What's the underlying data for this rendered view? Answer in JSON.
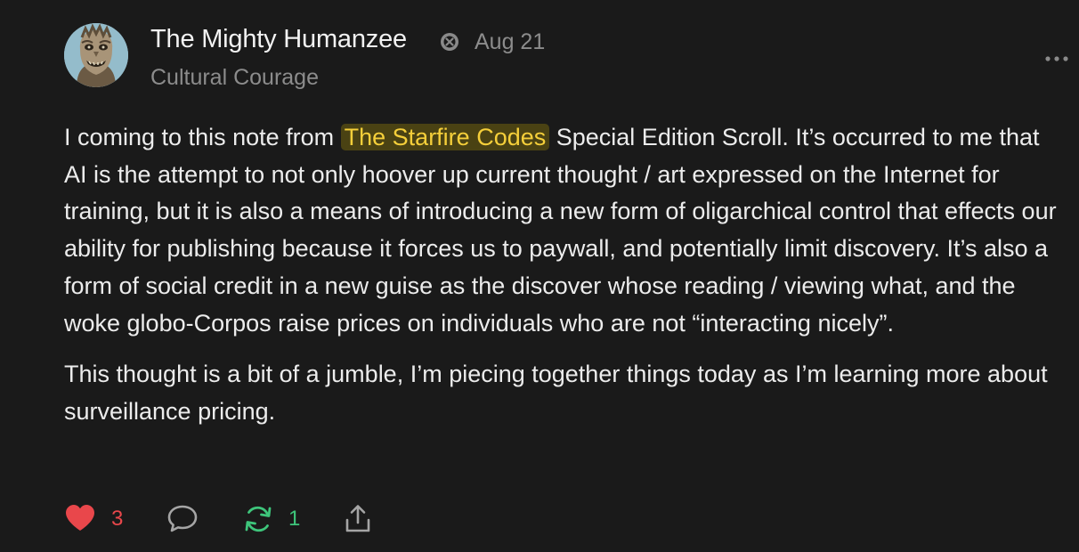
{
  "author": {
    "name": "The Mighty Humanzee",
    "badge_icon": "subscriber-badge-icon",
    "date": "Aug 21",
    "publication": "Cultural Courage"
  },
  "note": {
    "paragraph1": {
      "before_mention": "I coming to this note from ",
      "mention": "The Starfire Codes",
      "after_mention": " Special Edition Scroll. It’s occurred to me that AI is the attempt to not only hoover up current thought / art expressed on the Internet for training, but it is also a means of introducing a new form of oligarchical control that effects our ability for publishing because it forces us to paywall, and potentially limit discovery. It’s also a form of social credit in a new guise as the discover whose reading / viewing what, and the woke globo-Corpos raise prices on individuals who are not “interacting nicely”."
    },
    "paragraph2": "This thought is a bit of a jumble, I’m piecing together things today as I’m learning more about surveillance pricing."
  },
  "actions": {
    "like": {
      "icon": "heart-icon",
      "count": "3"
    },
    "comment": {
      "icon": "comment-bubble-icon"
    },
    "restack": {
      "icon": "restack-icon",
      "count": "1"
    },
    "share": {
      "icon": "share-icon"
    }
  },
  "more_icon": "more-dots-icon",
  "colors": {
    "background": "#1a1a1a",
    "text": "#ececec",
    "muted": "#8c8c8c",
    "mention_bg": "#4a4213",
    "mention_text": "#f5cf3a",
    "like": "#e9474b",
    "restack": "#3ec57b"
  }
}
